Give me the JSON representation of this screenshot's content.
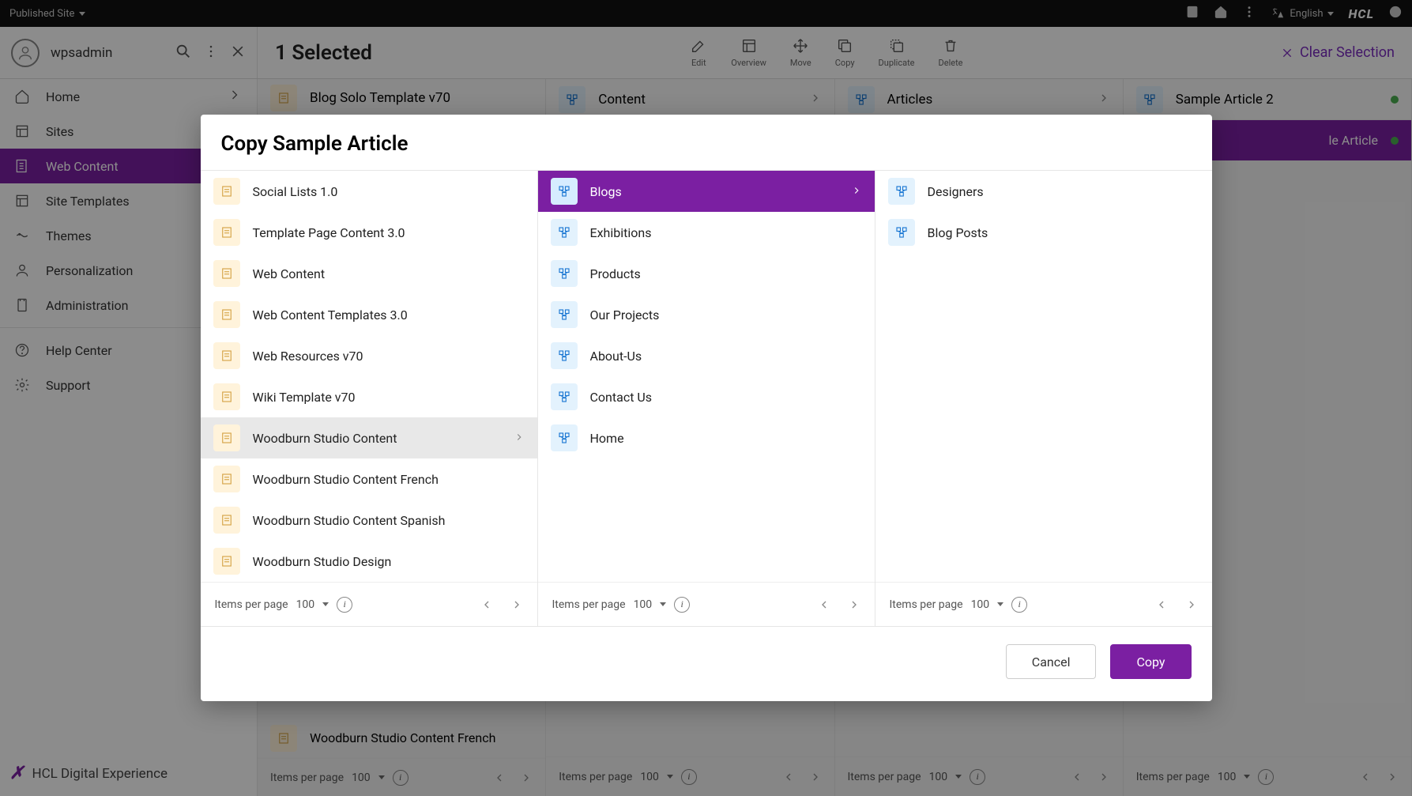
{
  "topbar": {
    "site_label": "Published Site",
    "language": "English"
  },
  "subbar": {
    "username": "wpsadmin",
    "selected": "1 Selected",
    "actions": {
      "edit": "Edit",
      "overview": "Overview",
      "move": "Move",
      "copy": "Copy",
      "duplicate": "Duplicate",
      "delete": "Delete"
    },
    "clear": "Clear Selection"
  },
  "sidebar": {
    "items": [
      {
        "label": "Home",
        "has_children": true
      },
      {
        "label": "Sites"
      },
      {
        "label": "Web Content",
        "active": true
      },
      {
        "label": "Site Templates"
      },
      {
        "label": "Themes"
      },
      {
        "label": "Personalization"
      },
      {
        "label": "Administration"
      }
    ],
    "support_items": [
      {
        "label": "Help Center"
      },
      {
        "label": "Support"
      }
    ],
    "footer": "HCL Digital Experience"
  },
  "background_cols": [
    {
      "title": "Blog Solo Template v70",
      "rows": [
        "Woodburn Studio Content French"
      ],
      "footer_label": "Items per page",
      "footer_value": "100"
    },
    {
      "title": "Content",
      "rows": [],
      "footer_label": "Items per page",
      "footer_value": "100"
    },
    {
      "title": "Articles",
      "rows": [],
      "footer_label": "Items per page",
      "footer_value": "100"
    },
    {
      "title": "Sample Article 2",
      "second_row": "le Article",
      "footer_label": "Items per page",
      "footer_value": "100"
    }
  ],
  "modal": {
    "title": "Copy Sample Article",
    "col1": [
      {
        "label": "Social Lists 1.0"
      },
      {
        "label": "Template Page Content 3.0"
      },
      {
        "label": "Web Content"
      },
      {
        "label": "Web Content Templates 3.0"
      },
      {
        "label": "Web Resources v70"
      },
      {
        "label": "Wiki Template v70"
      },
      {
        "label": "Woodburn Studio Content",
        "selected": true,
        "has_children": true
      },
      {
        "label": "Woodburn Studio Content French"
      },
      {
        "label": "Woodburn Studio Content Spanish"
      },
      {
        "label": "Woodburn Studio Design"
      }
    ],
    "col2": [
      {
        "label": "Blogs",
        "selected": true,
        "has_children": true
      },
      {
        "label": "Exhibitions"
      },
      {
        "label": "Products"
      },
      {
        "label": "Our Projects"
      },
      {
        "label": "About-Us"
      },
      {
        "label": "Contact Us"
      },
      {
        "label": "Home"
      }
    ],
    "col3": [
      {
        "label": "Designers"
      },
      {
        "label": "Blog Posts"
      }
    ],
    "footer_label": "Items per page",
    "footer_value": "100",
    "cancel": "Cancel",
    "copy": "Copy"
  }
}
